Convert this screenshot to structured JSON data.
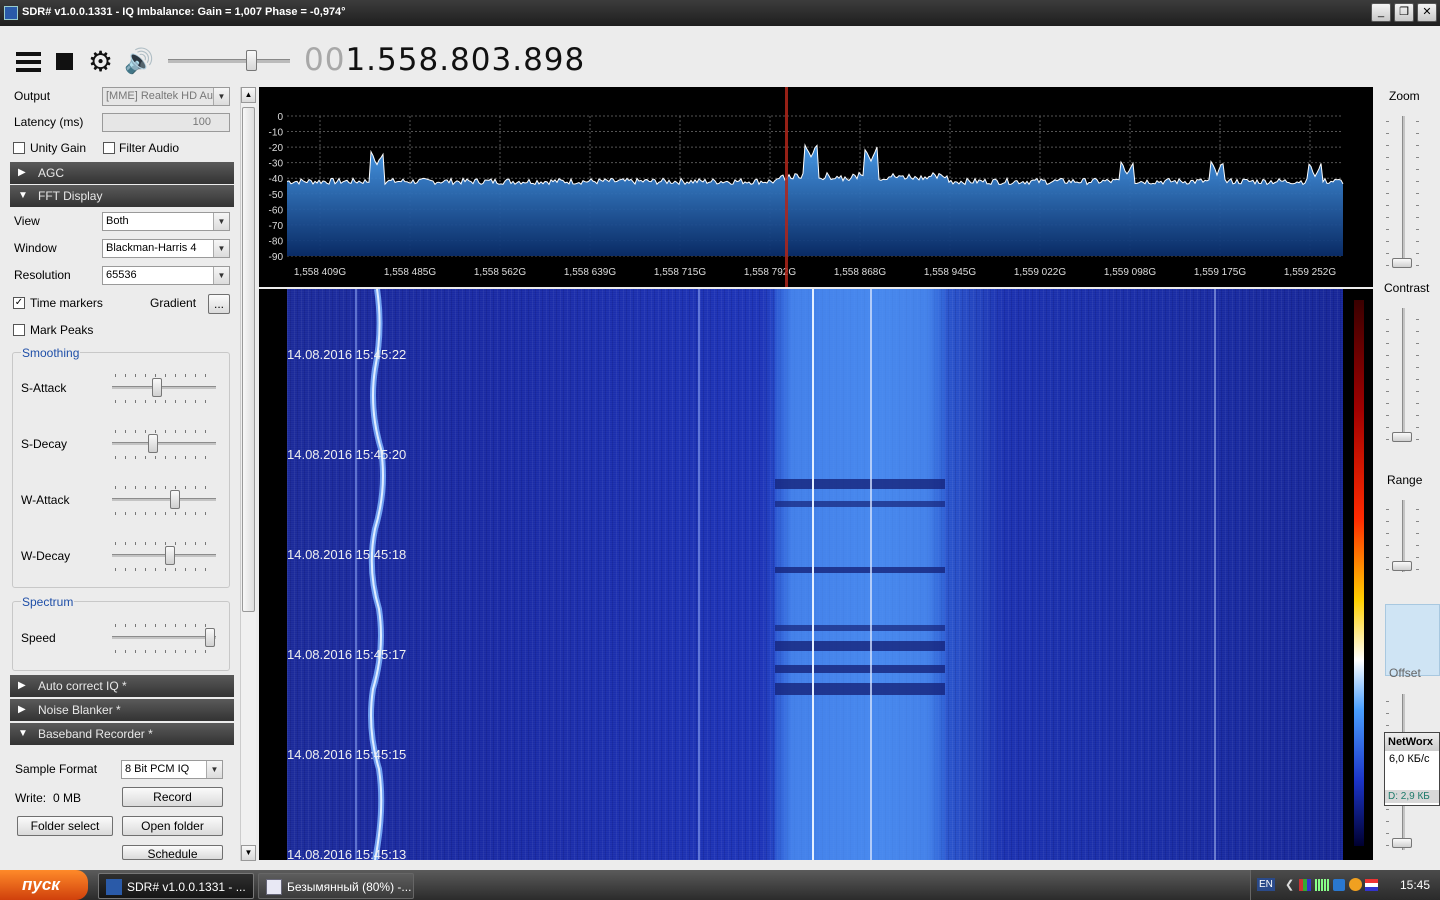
{
  "window": {
    "title": "SDR# v1.0.0.1331 - IQ Imbalance: Gain = 1,007 Phase = -0,974°",
    "minimize_label": "_",
    "restore_label": "❐",
    "close_label": "✕"
  },
  "toolbar": {
    "frequency_dim": "00",
    "frequency_main": "1.558.803.898",
    "volume": 0.7
  },
  "audio": {
    "output_label": "Output",
    "output_value": "[MME] Realtek HD Au",
    "latency_label": "Latency (ms)",
    "latency_value": "100",
    "unity_gain_label": "Unity Gain",
    "unity_gain_checked": false,
    "filter_audio_label": "Filter Audio",
    "filter_audio_checked": false
  },
  "sections": {
    "agc": "AGC",
    "fft_display": "FFT Display",
    "auto_correct_iq": "Auto correct IQ *",
    "noise_blanker": "Noise Blanker *",
    "baseband_recorder": "Baseband Recorder *"
  },
  "fft": {
    "view_label": "View",
    "view_value": "Both",
    "window_label": "Window",
    "window_value": "Blackman-Harris 4",
    "resolution_label": "Resolution",
    "resolution_value": "65536",
    "time_markers_label": "Time markers",
    "time_markers_checked": true,
    "gradient_label": "Gradient",
    "gradient_button": "...",
    "mark_peaks_label": "Mark Peaks",
    "mark_peaks_checked": false,
    "smoothing_title": "Smoothing",
    "s_attack_label": "S-Attack",
    "s_attack": 0.42,
    "s_decay_label": "S-Decay",
    "s_decay": 0.38,
    "w_attack_label": "W-Attack",
    "w_attack": 0.6,
    "w_decay_label": "W-Decay",
    "w_decay": 0.55,
    "spectrum_title": "Spectrum",
    "speed_label": "Speed",
    "speed": 0.97
  },
  "recorder": {
    "sample_format_label": "Sample Format",
    "sample_format_value": "8 Bit PCM IQ",
    "write_label": "Write:",
    "write_value": "0 MB",
    "record_button": "Record",
    "folder_select_button": "Folder select",
    "open_folder_button": "Open folder",
    "schedule_button": "Schedule"
  },
  "spectrum": {
    "db_labels": [
      "0",
      "-10",
      "-20",
      "-30",
      "-40",
      "-50",
      "-60",
      "-70",
      "-80",
      "-90"
    ],
    "freq_labels": [
      "1,558 409G",
      "1,558 485G",
      "1,558 562G",
      "1,558 639G",
      "1,558 715G",
      "1,558 792G",
      "1,558 868G",
      "1,558 945G",
      "1,559 022G",
      "1,559 098G",
      "1,559 175G",
      "1,559 252G"
    ],
    "colors": {
      "fill": "#2f7fd8",
      "trace": "#ffffff",
      "grid": "#555555",
      "marker": "#b0261a"
    }
  },
  "waterfall": {
    "timestamps": [
      "14.08.2016 15:45:22",
      "14.08.2016 15:45:20",
      "14.08.2016 15:45:18",
      "14.08.2016 15:45:17",
      "14.08.2016 15:45:15",
      "14.08.2016 15:45:13"
    ]
  },
  "right_panel": {
    "zoom_label": "Zoom",
    "contrast_label": "Contrast",
    "range_label": "Range",
    "offset_label": "Offset",
    "zoom": 0.0,
    "contrast": 0.0,
    "range": 0.0
  },
  "networx": {
    "title": "NetWorx",
    "rate": "6,0 КБ/с",
    "download": "D: 2,9 КБ"
  },
  "taskbar": {
    "start_label": "пуск",
    "task1": "SDR# v1.0.0.1331 - ...",
    "task2": "Безымянный (80%) -...",
    "lang": "EN",
    "clock": "15:45"
  }
}
